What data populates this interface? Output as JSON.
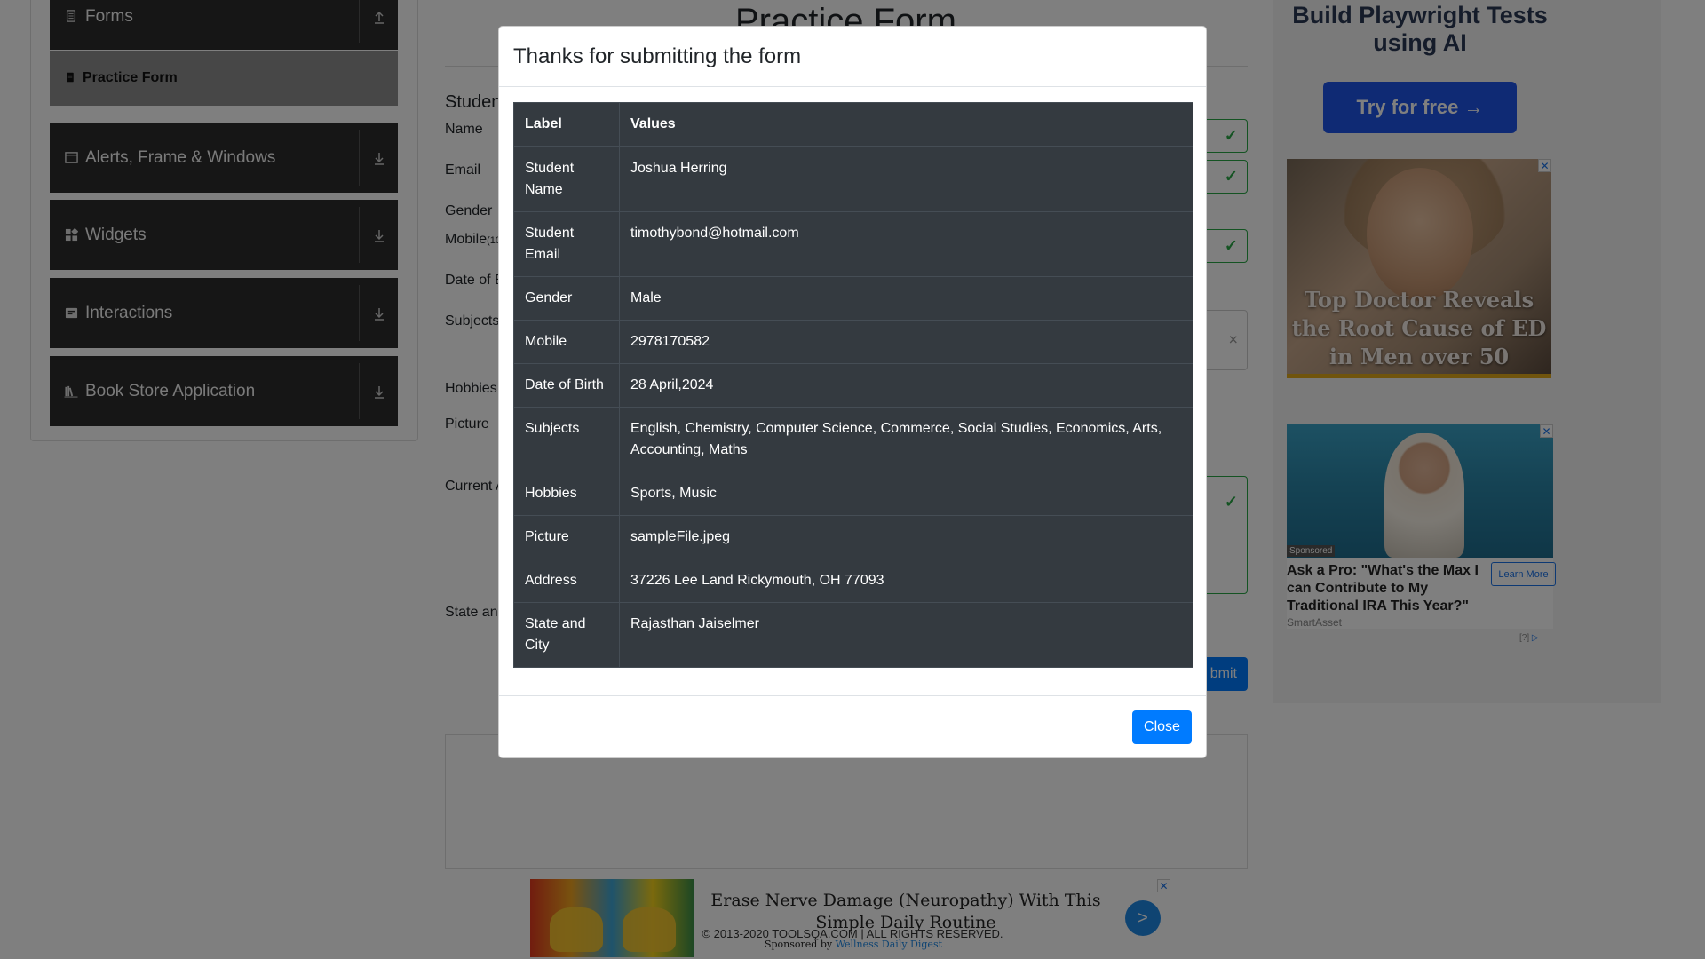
{
  "sidebar": {
    "groups": [
      {
        "name": "Forms",
        "icon": "document-icon"
      },
      {
        "name": "Alerts, Frame & Windows",
        "icon": "window-icon"
      },
      {
        "name": "Widgets",
        "icon": "widgets-icon"
      },
      {
        "name": "Interactions",
        "icon": "interactions-icon"
      },
      {
        "name": "Book Store Application",
        "icon": "book-icon"
      }
    ],
    "active_item": "Practice Form"
  },
  "form": {
    "title": "Practice Form",
    "subtitle": "Studen",
    "labels": {
      "name": "Name",
      "email": "Email",
      "gender": "Gender",
      "mobile": "Mobile",
      "mobile_hint": "(10",
      "dob": "Date of B",
      "subjects": "Subjects",
      "hobbies": "Hobbies",
      "picture": "Picture",
      "address": "Current A",
      "state": "State an"
    },
    "submit_label": "Submit",
    "submit_visible": "bmit"
  },
  "modal": {
    "title": "Thanks for submitting the form",
    "table_headers": [
      "Label",
      "Values"
    ],
    "rows": [
      {
        "label": "Student Name",
        "value": "Joshua Herring"
      },
      {
        "label": "Student Email",
        "value": "timothybond@hotmail.com"
      },
      {
        "label": "Gender",
        "value": "Male"
      },
      {
        "label": "Mobile",
        "value": "2978170582"
      },
      {
        "label": "Date of Birth",
        "value": "28 April,2024"
      },
      {
        "label": "Subjects",
        "value": "English, Chemistry, Computer Science, Commerce, Social Studies, Economics, Arts, Accounting, Maths"
      },
      {
        "label": "Hobbies",
        "value": "Sports, Music"
      },
      {
        "label": "Picture",
        "value": "sampleFile.jpeg"
      },
      {
        "label": "Address",
        "value": "37226 Lee Land Rickymouth, OH 77093"
      },
      {
        "label": "State and City",
        "value": "Rajasthan Jaiselmer"
      }
    ],
    "close_label": "Close"
  },
  "ads": {
    "ad1_heading": "Build Playwright Tests using AI",
    "ad1_button": "Try for free →",
    "ad2_text": "Top Doctor Reveals the Root Cause of ED in Men over 50",
    "ad3_badge": "Sponsored",
    "ad3_title": "Ask a Pro: \"What's the Max I can Contribute to My Traditional IRA This Year?\"",
    "ad3_button": "Learn More",
    "ad3_source": "SmartAsset",
    "ad3_info": "[?]",
    "bottom_text": "Erase Nerve Damage (Neuropathy) With This Simple Daily Routine",
    "bottom_sponsor_prefix": "Sponsored by",
    "bottom_sponsor_name": "Wellness Daily Digest",
    "bottom_arrow": ">"
  },
  "footer": {
    "text": "© 2013-2020 TOOLSQA.COM | ALL RIGHTS RESERVED."
  },
  "colors": {
    "primary": "#007bff",
    "success": "#28a745",
    "table_dark": "#343a40",
    "sidebar_dark": "#2d2d2d"
  }
}
